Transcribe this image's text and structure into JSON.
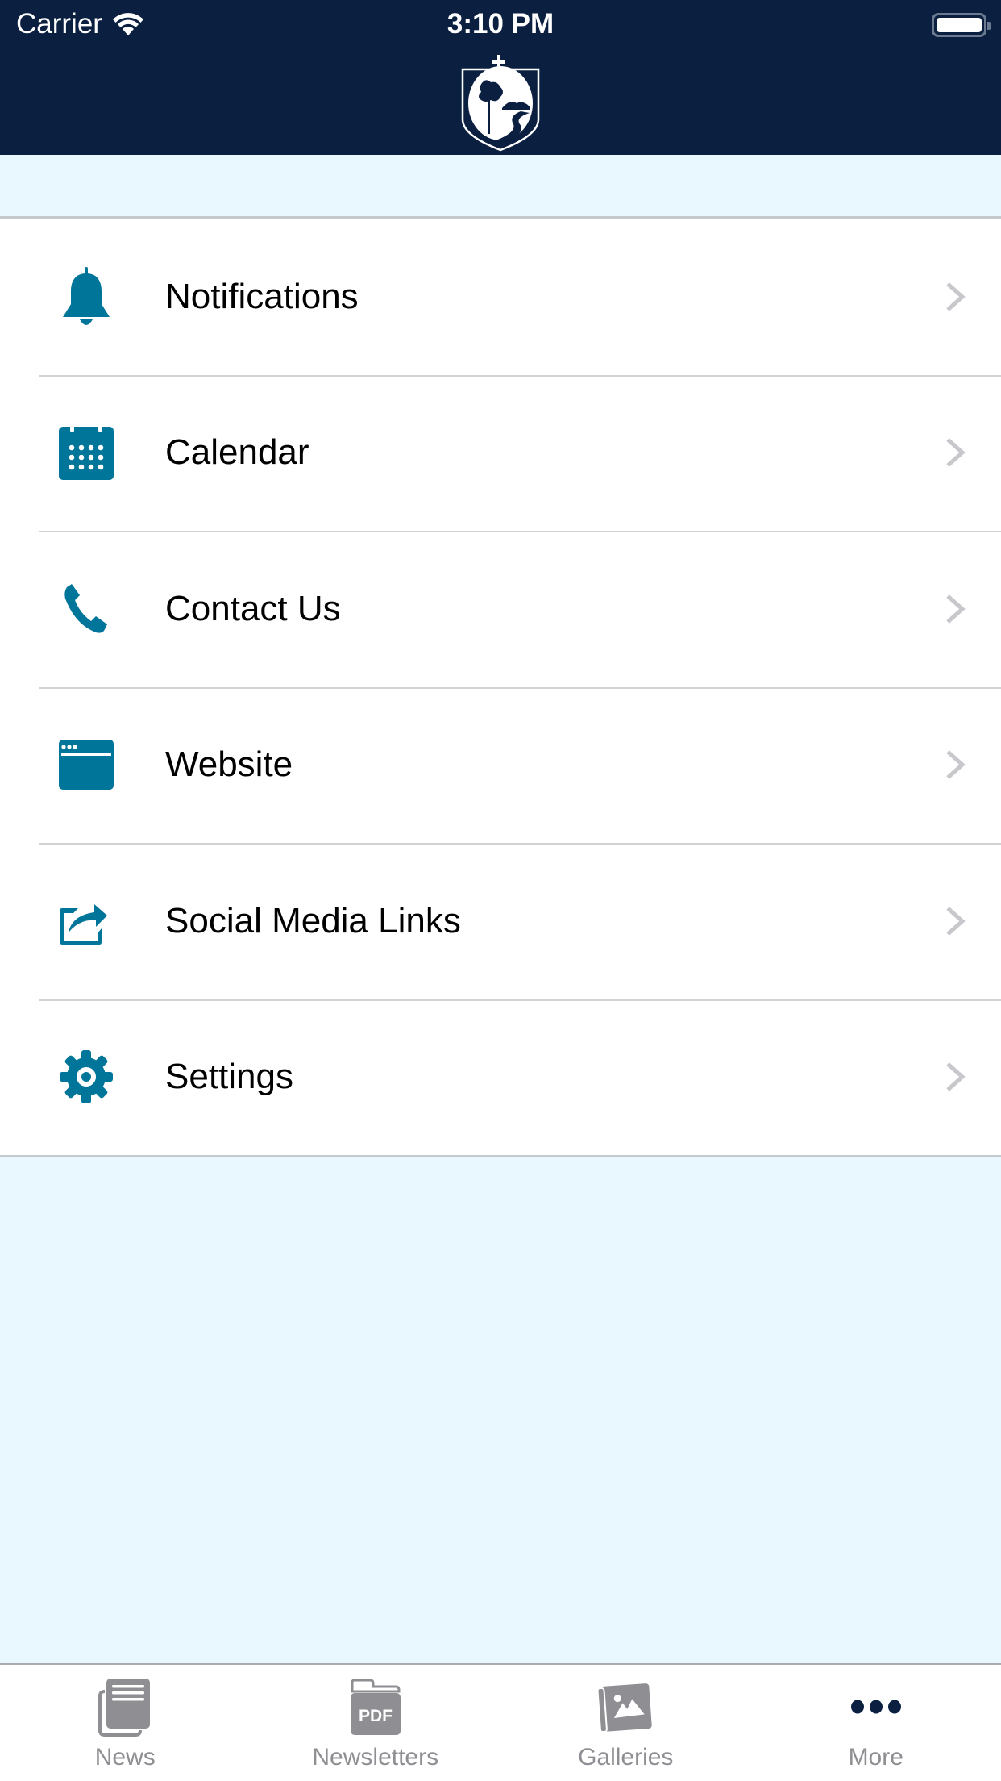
{
  "status_bar": {
    "carrier": "Carrier",
    "time": "3:10 PM",
    "wifi_icon": "wifi-icon",
    "battery_icon": "battery-full-icon"
  },
  "header": {
    "logo": "school-crest-logo",
    "background_color": "#0b1f40"
  },
  "menu": {
    "accent_color": "#00759a",
    "items": [
      {
        "label": "Notifications",
        "icon": "bell-icon"
      },
      {
        "label": "Calendar",
        "icon": "calendar-icon"
      },
      {
        "label": "Contact Us",
        "icon": "phone-icon"
      },
      {
        "label": "Website",
        "icon": "browser-window-icon"
      },
      {
        "label": "Social Media Links",
        "icon": "share-icon"
      },
      {
        "label": "Settings",
        "icon": "gear-icon"
      }
    ]
  },
  "tab_bar": {
    "active": "More",
    "active_color": "#0b1f40",
    "inactive_color": "#8e8e93",
    "tabs": [
      {
        "label": "News",
        "icon": "news-icon"
      },
      {
        "label": "Newsletters",
        "icon": "pdf-folder-icon",
        "icon_text": "PDF"
      },
      {
        "label": "Galleries",
        "icon": "gallery-icon"
      },
      {
        "label": "More",
        "icon": "more-dots-icon"
      }
    ]
  }
}
